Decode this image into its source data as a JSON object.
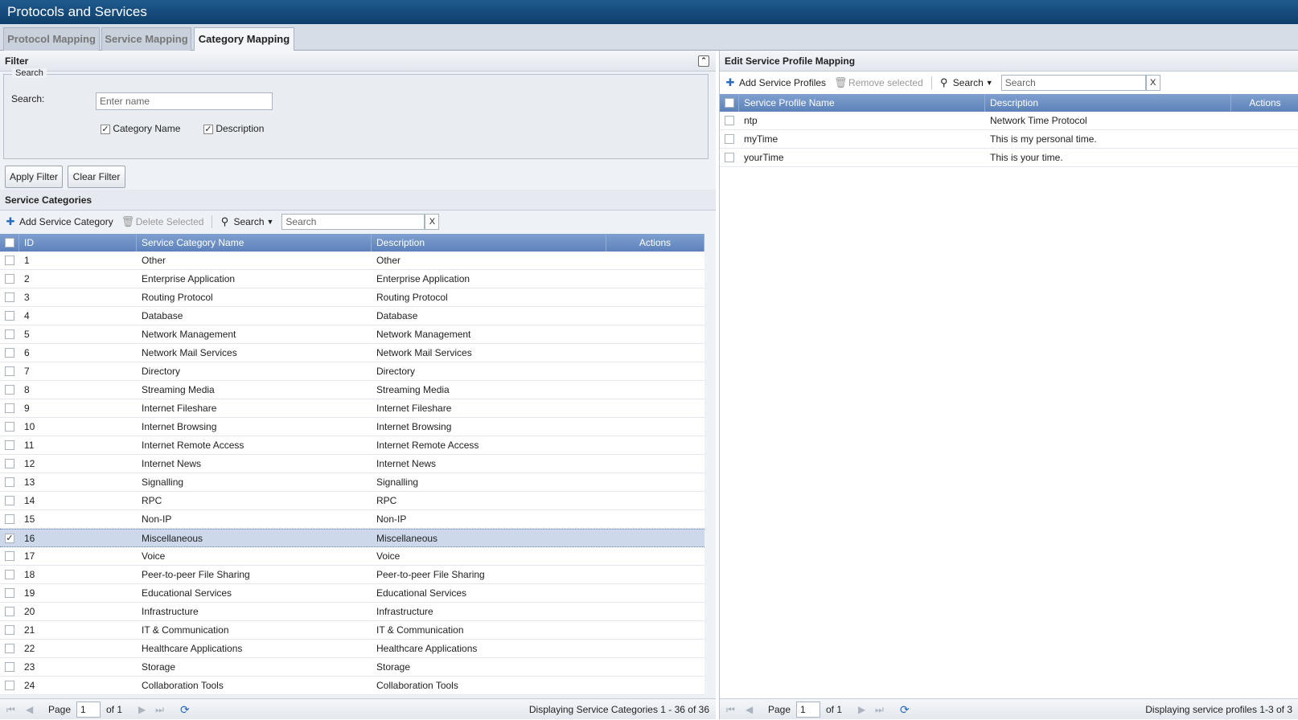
{
  "app": {
    "title": "Protocols and Services"
  },
  "tabs": [
    {
      "label": "Protocol Mapping"
    },
    {
      "label": "Service Mapping"
    },
    {
      "label": "Category Mapping"
    }
  ],
  "filter": {
    "title": "Filter",
    "collapse_icon": "collapse-up-icon",
    "legend": "Search",
    "search_label": "Search:",
    "search_placeholder": "Enter name",
    "search_value": "",
    "checkbox_category_name": {
      "label": "Category Name",
      "checked": true
    },
    "checkbox_description": {
      "label": "Description",
      "checked": true
    },
    "apply_label": "Apply Filter",
    "clear_label": "Clear Filter"
  },
  "categories": {
    "title": "Service Categories",
    "toolbar": {
      "add_label": "Add Service Category",
      "delete_label": "Delete Selected",
      "search_menu_label": "Search",
      "search_placeholder": "Search",
      "clear_icon": "X"
    },
    "columns": {
      "id": "ID",
      "name": "Service Category Name",
      "description": "Description",
      "actions": "Actions"
    },
    "rows": [
      {
        "id": "1",
        "name": "Other",
        "description": "Other",
        "checked": false
      },
      {
        "id": "2",
        "name": "Enterprise Application",
        "description": "Enterprise Application",
        "checked": false
      },
      {
        "id": "3",
        "name": "Routing Protocol",
        "description": "Routing Protocol",
        "checked": false
      },
      {
        "id": "4",
        "name": "Database",
        "description": "Database",
        "checked": false
      },
      {
        "id": "5",
        "name": "Network Management",
        "description": "Network Management",
        "checked": false
      },
      {
        "id": "6",
        "name": "Network Mail Services",
        "description": "Network Mail Services",
        "checked": false
      },
      {
        "id": "7",
        "name": "Directory",
        "description": "Directory",
        "checked": false
      },
      {
        "id": "8",
        "name": "Streaming Media",
        "description": "Streaming Media",
        "checked": false
      },
      {
        "id": "9",
        "name": "Internet Fileshare",
        "description": "Internet Fileshare",
        "checked": false
      },
      {
        "id": "10",
        "name": "Internet Browsing",
        "description": "Internet Browsing",
        "checked": false
      },
      {
        "id": "11",
        "name": "Internet Remote Access",
        "description": "Internet Remote Access",
        "checked": false
      },
      {
        "id": "12",
        "name": "Internet News",
        "description": "Internet News",
        "checked": false
      },
      {
        "id": "13",
        "name": "Signalling",
        "description": "Signalling",
        "checked": false
      },
      {
        "id": "14",
        "name": "RPC",
        "description": "RPC",
        "checked": false
      },
      {
        "id": "15",
        "name": "Non-IP",
        "description": "Non-IP",
        "checked": false
      },
      {
        "id": "16",
        "name": "Miscellaneous",
        "description": "Miscellaneous",
        "checked": true
      },
      {
        "id": "17",
        "name": "Voice",
        "description": "Voice",
        "checked": false
      },
      {
        "id": "18",
        "name": "Peer-to-peer File Sharing",
        "description": "Peer-to-peer File Sharing",
        "checked": false
      },
      {
        "id": "19",
        "name": "Educational Services",
        "description": "Educational Services",
        "checked": false
      },
      {
        "id": "20",
        "name": "Infrastructure",
        "description": "Infrastructure",
        "checked": false
      },
      {
        "id": "21",
        "name": "IT & Communication",
        "description": "IT & Communication",
        "checked": false
      },
      {
        "id": "22",
        "name": "Healthcare Applications",
        "description": "Healthcare Applications",
        "checked": false
      },
      {
        "id": "23",
        "name": "Storage",
        "description": "Storage",
        "checked": false
      },
      {
        "id": "24",
        "name": "Collaboration Tools",
        "description": "Collaboration Tools",
        "checked": false
      }
    ],
    "pager": {
      "page_label": "Page",
      "page_value": "1",
      "of_label": "of 1",
      "status": "Displaying Service Categories 1 - 36 of 36"
    }
  },
  "profiles": {
    "title": "Edit Service Profile Mapping",
    "toolbar": {
      "add_label": "Add Service Profiles",
      "remove_label": "Remove selected",
      "search_menu_label": "Search",
      "search_placeholder": "Search",
      "clear_icon": "X"
    },
    "columns": {
      "name": "Service Profile Name",
      "description": "Description",
      "actions": "Actions"
    },
    "rows": [
      {
        "name": "ntp",
        "description": "Network Time Protocol",
        "checked": false
      },
      {
        "name": "myTime",
        "description": "This is my personal time.",
        "checked": false
      },
      {
        "name": "yourTime",
        "description": "This is your time.",
        "checked": false
      }
    ],
    "pager": {
      "page_label": "Page",
      "page_value": "1",
      "of_label": "of 1",
      "status": "Displaying service profiles 1-3 of 3"
    }
  },
  "icons": {
    "add": "plus-icon",
    "delete": "trash-icon",
    "search": "magnifier-icon",
    "refresh": "refresh-icon",
    "first": "first-page-icon",
    "prev": "prev-page-icon",
    "next": "next-page-icon",
    "last": "last-page-icon"
  },
  "colors": {
    "titlebar": "#0e3e6b",
    "grid_header": "#5d82bb",
    "selected_row": "#cdd8ea",
    "accent_icon": "#2a6bbf"
  }
}
